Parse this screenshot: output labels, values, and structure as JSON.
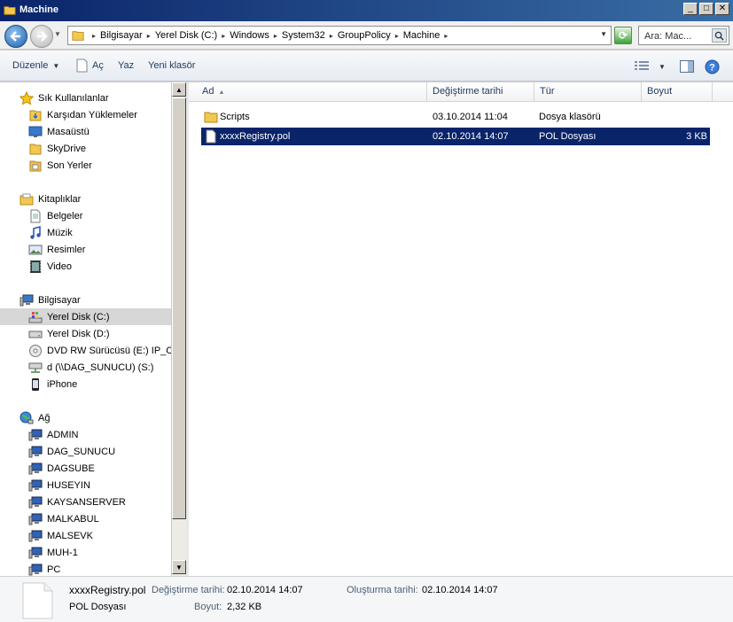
{
  "window": {
    "title": "Machine"
  },
  "address": {
    "breadcrumbs": [
      "Bilgisayar",
      "Yerel Disk (C:)",
      "Windows",
      "System32",
      "GroupPolicy",
      "Machine"
    ],
    "search_placeholder": "Ara: Mac..."
  },
  "toolbar": {
    "organize": "Düzenle",
    "open": "Aç",
    "print": "Yaz",
    "new_folder": "Yeni klasör"
  },
  "sidebar": {
    "favorites": {
      "title": "Sık Kullanılanlar",
      "items": [
        "Karşıdan Yüklemeler",
        "Masaüstü",
        "SkyDrive",
        "Son Yerler"
      ]
    },
    "libraries": {
      "title": "Kitaplıklar",
      "items": [
        "Belgeler",
        "Müzik",
        "Resimler",
        "Video"
      ]
    },
    "computer": {
      "title": "Bilgisayar",
      "items": [
        "Yerel Disk (C:)",
        "Yerel Disk (D:)",
        "DVD RW Sürücüsü (E:) IP_CA",
        "d (\\\\DAG_SUNUCU) (S:)",
        "iPhone"
      ]
    },
    "network": {
      "title": "Ağ",
      "items": [
        "ADMIN",
        "DAG_SUNUCU",
        "DAGSUBE",
        "HUSEYIN",
        "KAYSANSERVER",
        "MALKABUL",
        "MALSEVK",
        "MUH-1",
        "PC"
      ]
    }
  },
  "file_list": {
    "columns": [
      "Ad",
      "Değiştirme tarihi",
      "Tür",
      "Boyut"
    ],
    "rows": [
      {
        "name": "Scripts",
        "modified": "03.10.2014 11:04",
        "type": "Dosya klasörü",
        "size": ""
      },
      {
        "name": "xxxxRegistry.pol",
        "modified": "02.10.2014 14:07",
        "type": "POL Dosyası",
        "size": "3 KB"
      }
    ]
  },
  "details": {
    "filename": "xxxxRegistry.pol",
    "modified_label": "Değiştirme tarihi:",
    "modified_value": "02.10.2014 14:07",
    "created_label": "Oluşturma tarihi:",
    "created_value": "02.10.2014 14:07",
    "type": "POL Dosyası",
    "size_label": "Boyut:",
    "size_value": "2,32 KB"
  },
  "colors": {
    "selection": "#0a246a",
    "nav_selected": "#d7d7d7",
    "link_text": "#1e395b"
  }
}
